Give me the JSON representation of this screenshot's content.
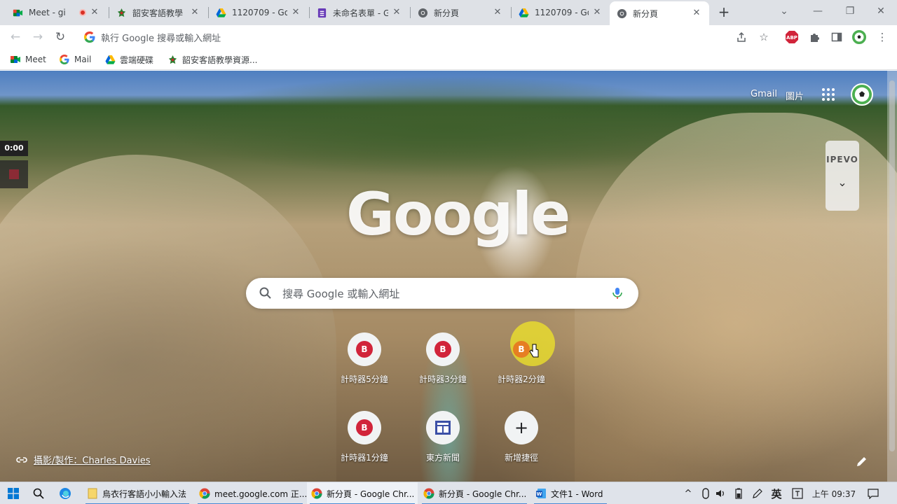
{
  "tabs": [
    {
      "title": "Meet - gi",
      "recording": true
    },
    {
      "title": "韶安客語教學"
    },
    {
      "title": "1120709 - Go"
    },
    {
      "title": "未命名表單 - G"
    },
    {
      "title": "新分頁"
    },
    {
      "title": "1120709 - Go"
    },
    {
      "title": "新分頁",
      "active": true
    }
  ],
  "omnibox": {
    "placeholder": "執行 Google 搜尋或輸入網址"
  },
  "bookmarks": [
    {
      "label": "Meet"
    },
    {
      "label": "Mail"
    },
    {
      "label": "雲端硬碟"
    },
    {
      "label": "韶安客語教學資源..."
    }
  ],
  "extensions": {
    "abp": "ABP"
  },
  "ntp": {
    "gmail": "Gmail",
    "images": "圖片",
    "logo": "Google",
    "search_placeholder": "搜尋 Google 或輸入網址",
    "shortcuts": [
      {
        "label": "計時器5分鐘",
        "icon_letter": "B"
      },
      {
        "label": "計時器3分鐘",
        "icon_letter": "B"
      },
      {
        "label": "計時器2分鐘",
        "icon_letter": "B",
        "highlighted": true
      },
      {
        "label": "計時器1分鐘",
        "icon_letter": "B"
      },
      {
        "label": "東方新聞",
        "icon": "news-icon"
      },
      {
        "label": "新增捷徑",
        "icon": "plus-icon"
      }
    ],
    "credit": "攝影/製作：Charles Davies"
  },
  "overlay": {
    "timer": "0:00",
    "ipevo_brand": "IPEVO"
  },
  "taskbar": {
    "apps": [
      {
        "label": "烏衣行客語小小輸入法"
      },
      {
        "label": "meet.google.com 正..."
      },
      {
        "label": "新分頁 - Google Chr..."
      },
      {
        "label": "新分頁 - Google Chr..."
      },
      {
        "label": "文件1 - Word"
      }
    ],
    "ime": "英",
    "clock": "上午 09:37"
  },
  "colors": {
    "accent": "#1a73e8",
    "shortcut_icon": "#d1243a",
    "highlight": "#f0e628"
  }
}
